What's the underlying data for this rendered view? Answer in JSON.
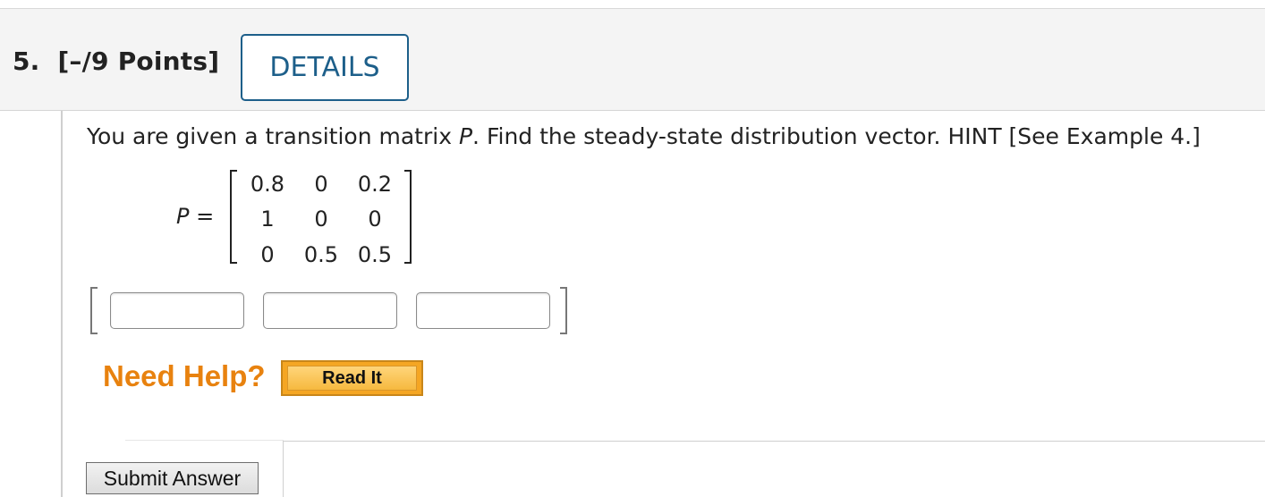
{
  "question": {
    "number": "5.",
    "points": "[–/9 Points]",
    "details_label": "DETAILS",
    "text_before": "You are given a transition matrix ",
    "text_var": "P",
    "text_after": ". Find the steady-state distribution vector. HINT [See Example 4.]"
  },
  "matrix": {
    "label_var": "P",
    "label_eq": " =",
    "rows": [
      [
        "0.8",
        "0",
        "0.2"
      ],
      [
        "1",
        "0",
        "0"
      ],
      [
        "0",
        "0.5",
        "0.5"
      ]
    ]
  },
  "answer": {
    "fields": [
      "",
      "",
      ""
    ]
  },
  "help": {
    "need_help_label": "Need Help?",
    "read_it_label": "Read It"
  },
  "actions": {
    "submit_label": "Submit Answer"
  }
}
